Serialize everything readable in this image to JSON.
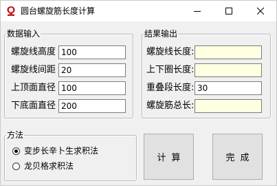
{
  "window": {
    "title": "圆台螺旋筋长度计算",
    "icon": "red-omega-logo-icon",
    "controls": {
      "minimize": "minimize-icon",
      "maximize": "maximize-icon",
      "close": "close-icon"
    }
  },
  "input_group": {
    "title": "数据输入",
    "fields": [
      {
        "label": "螺旋线高度",
        "value": "100"
      },
      {
        "label": "螺旋线间距",
        "value": "20"
      },
      {
        "label": "上顶面直径",
        "value": "100"
      },
      {
        "label": "下底面直径",
        "value": "200"
      }
    ]
  },
  "output_group": {
    "title": "结果输出",
    "fields": [
      {
        "label": "螺旋线长度:",
        "value": ""
      },
      {
        "label": "上下圈长度:",
        "value": ""
      },
      {
        "label": "重叠段长度:",
        "value": "30"
      },
      {
        "label": "螺旋筋总长:",
        "value": ""
      }
    ]
  },
  "method_group": {
    "title": "方法",
    "options": [
      {
        "label": "变步长辛卜生求积法",
        "selected": true
      },
      {
        "label": "龙贝格求积法",
        "selected": false
      }
    ]
  },
  "buttons": {
    "calculate": "计算",
    "done": "完成"
  },
  "colors": {
    "window_bg": "#f0f0f0",
    "readonly_field_bg": "#ffffe1",
    "icon_red": "#c00000"
  }
}
